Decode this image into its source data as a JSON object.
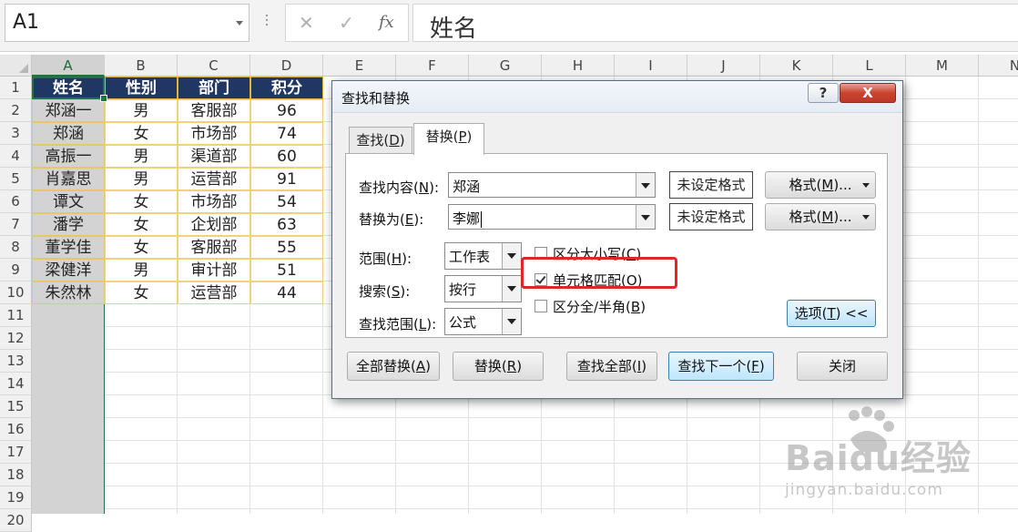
{
  "formula_bar": {
    "name_box": "A1",
    "cancel_icon": "✕",
    "enter_icon": "✓",
    "fx_label": "fx",
    "content": "姓名"
  },
  "grid": {
    "columns": [
      "A",
      "B",
      "C",
      "D",
      "E",
      "F",
      "G",
      "H",
      "I",
      "J",
      "K",
      "L",
      "M",
      "N"
    ],
    "rows": [
      "1",
      "2",
      "3",
      "4",
      "5",
      "6",
      "7",
      "8",
      "9",
      "10",
      "11",
      "12",
      "13",
      "14",
      "15",
      "16",
      "17",
      "18",
      "19",
      "20"
    ],
    "selected_cell": "A1"
  },
  "table": {
    "headers": [
      "姓名",
      "性别",
      "部门",
      "积分"
    ],
    "rows": [
      [
        "郑涵一",
        "男",
        "客服部",
        "96"
      ],
      [
        "郑涵",
        "女",
        "市场部",
        "74"
      ],
      [
        "高振一",
        "男",
        "渠道部",
        "60"
      ],
      [
        "肖嘉思",
        "男",
        "运营部",
        "91"
      ],
      [
        "谭文",
        "女",
        "市场部",
        "54"
      ],
      [
        "潘学",
        "女",
        "企划部",
        "63"
      ],
      [
        "董学佳",
        "女",
        "客服部",
        "55"
      ],
      [
        "梁健洋",
        "男",
        "审计部",
        "51"
      ],
      [
        "朱然林",
        "女",
        "运营部",
        "44"
      ]
    ]
  },
  "dialog": {
    "title": "查找和替换",
    "help_label": "?",
    "close_label": "X",
    "tab_find": {
      "text": "查找(",
      "key": "D",
      "end": ")"
    },
    "tab_replace": {
      "text": "替换(",
      "key": "P",
      "end": ")"
    },
    "find_label": {
      "text": "查找内容(",
      "key": "N",
      "end": "):"
    },
    "find_value": "郑涵",
    "replace_label": {
      "text": "替换为(",
      "key": "E",
      "end": "):"
    },
    "replace_value": "李娜",
    "format_preview_1": "未设定格式",
    "format_preview_2": "未设定格式",
    "format_button_1": {
      "text": "格式(",
      "key": "M",
      "end": ")..."
    },
    "format_button_2": {
      "text": "格式(",
      "key": "M",
      "end": ")..."
    },
    "within_label": {
      "text": "范围(",
      "key": "H",
      "end": "):"
    },
    "within_value": "工作表",
    "search_label": {
      "text": "搜索(",
      "key": "S",
      "end": "):"
    },
    "search_value": "按行",
    "lookin_label": {
      "text": "查找范围(",
      "key": "L",
      "end": "):"
    },
    "lookin_value": "公式",
    "match_case": {
      "text": "区分大小写(",
      "key": "C",
      "end": ")",
      "checked": false
    },
    "match_cell": {
      "text": "单元格匹配(",
      "key": "O",
      "end": ")",
      "checked": true
    },
    "match_byte": {
      "text": "区分全/半角(",
      "key": "B",
      "end": ")",
      "checked": false
    },
    "options_button": {
      "text": "选项(",
      "key": "T",
      "end": ") <<"
    },
    "replace_all_button": {
      "text": "全部替换(",
      "key": "A",
      "end": ")"
    },
    "replace_button": {
      "text": "替换(",
      "key": "R",
      "end": ")"
    },
    "find_all_button": {
      "text": "查找全部(",
      "key": "I",
      "end": ")"
    },
    "find_next_button": {
      "text": "查找下一个(",
      "key": "F",
      "end": ")"
    },
    "close_button": "关闭"
  },
  "watermark": {
    "brand": "Baidu经验",
    "url": "jingyan.baidu.com"
  }
}
